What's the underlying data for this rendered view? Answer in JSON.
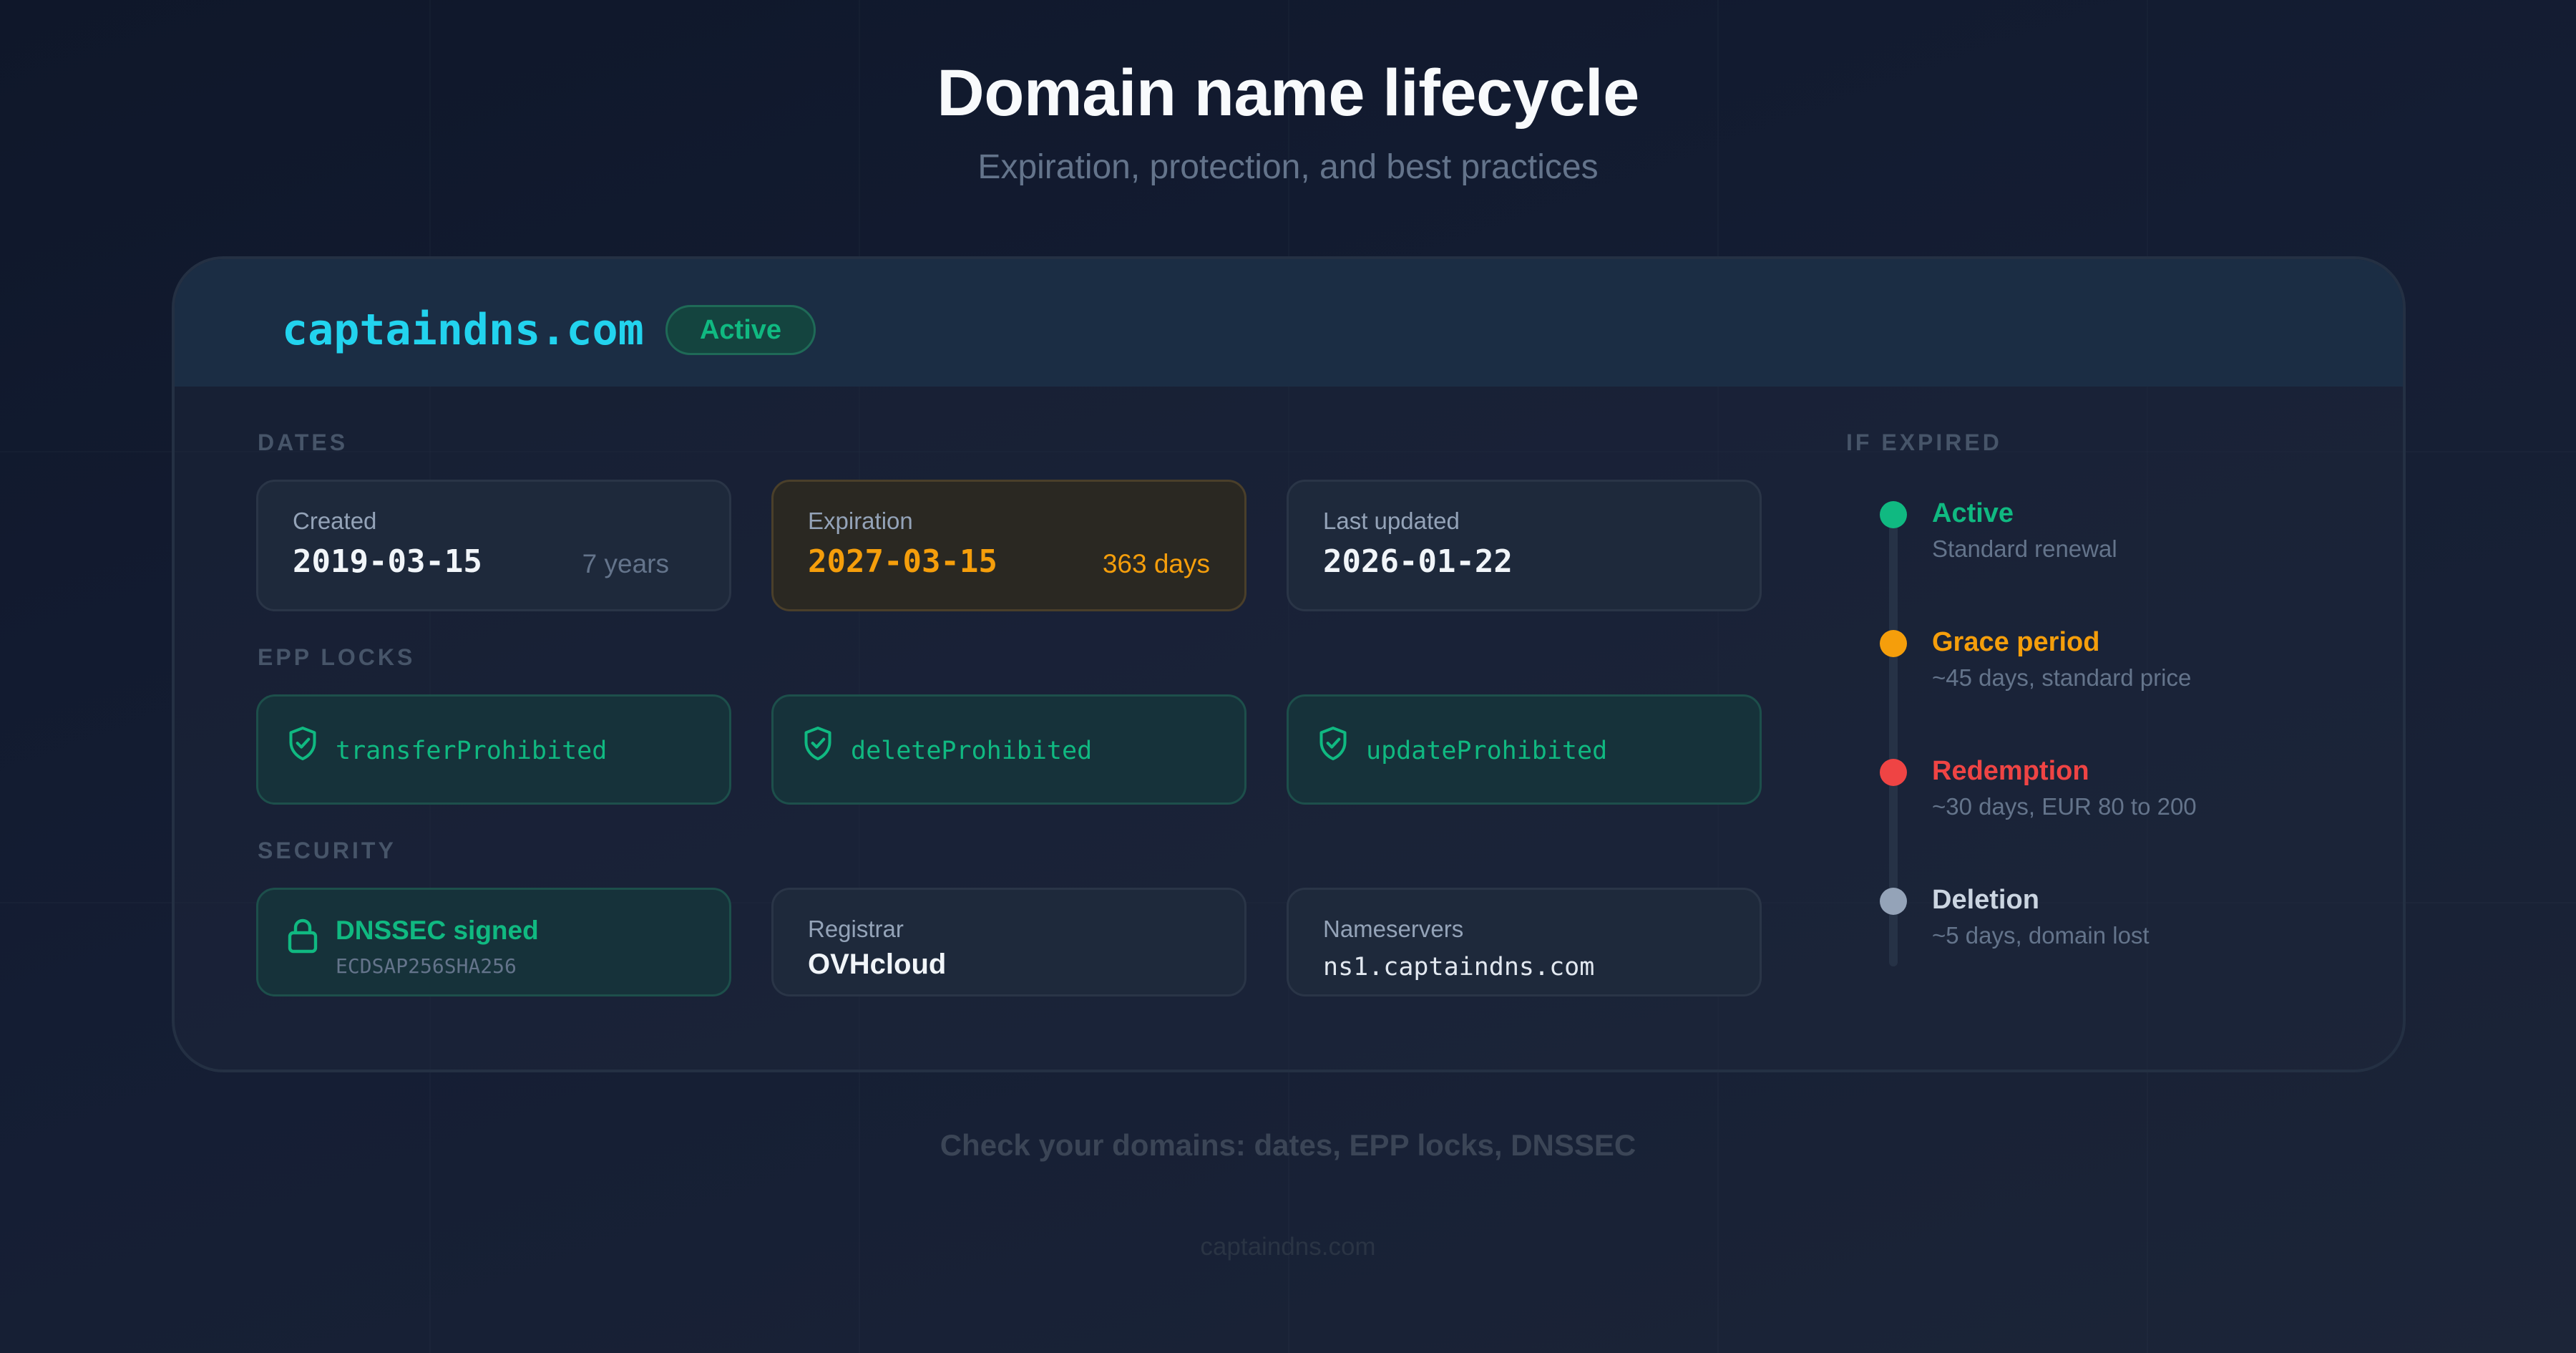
{
  "header": {
    "title": "Domain name lifecycle",
    "subtitle": "Expiration, protection, and best practices"
  },
  "card": {
    "domain": "captaindns.com",
    "status": "Active"
  },
  "dates": {
    "label": "DATES",
    "created": {
      "label": "Created",
      "value": "2019-03-15",
      "aside": "7 years"
    },
    "expiration": {
      "label": "Expiration",
      "value": "2027-03-15",
      "aside": "363 days"
    },
    "updated": {
      "label": "Last updated",
      "value": "2026-01-22"
    }
  },
  "epp": {
    "label": "EPP LOCKS",
    "locks": [
      "transferProhibited",
      "deleteProhibited",
      "updateProhibited"
    ]
  },
  "security": {
    "label": "SECURITY",
    "dnssec": {
      "title": "DNSSEC signed",
      "algorithm": "ECDSAP256SHA256"
    },
    "registrar": {
      "label": "Registrar",
      "value": "OVHcloud"
    },
    "nameservers": {
      "label": "Nameservers",
      "value": "ns1.captaindns.com"
    }
  },
  "expired": {
    "label": "IF EXPIRED",
    "stages": [
      {
        "title": "Active",
        "desc": "Standard renewal",
        "color": "#10b981"
      },
      {
        "title": "Grace period",
        "desc": "~45 days, standard price",
        "color": "#f59e0b"
      },
      {
        "title": "Redemption",
        "desc": "~30 days, EUR 80 to 200",
        "color": "#ef4444"
      },
      {
        "title": "Deletion",
        "desc": "~5 days, domain lost",
        "color": "#94a3b8"
      }
    ]
  },
  "footer": {
    "cta": "Check your domains: dates, EPP locks, DNSSEC",
    "brand": "captaindns.com"
  },
  "icons": {
    "lock": "shield-check-icon",
    "dnssec": "padlock-icon"
  }
}
